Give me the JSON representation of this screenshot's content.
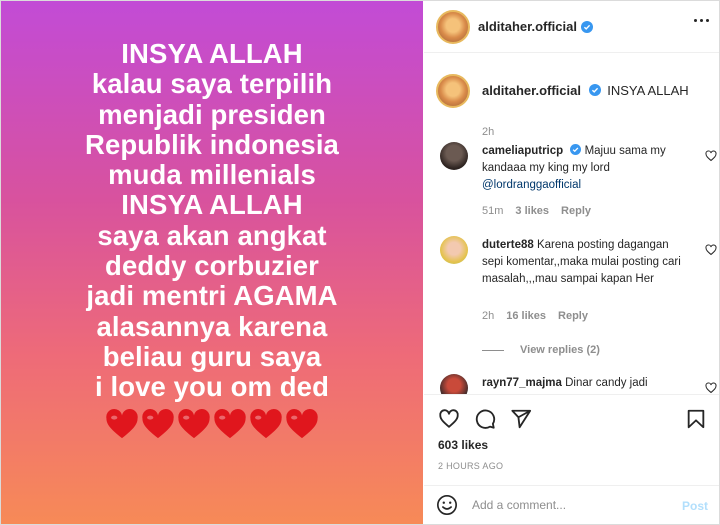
{
  "post_image": {
    "lines": [
      "INSYA ALLAH",
      "kalau saya terpilih",
      "menjadi presiden",
      "Republik indonesia",
      "muda millenials",
      "INSYA ALLAH",
      "saya akan angkat",
      "deddy corbuzier",
      "jadi mentri AGAMA",
      "alasannya karena",
      "beliau guru saya",
      "i love you om ded"
    ],
    "hearts_count": 6,
    "heart_color": "#e0161d",
    "gradient_top": "#c24bd6",
    "gradient_bottom": "#f78a57"
  },
  "header": {
    "username": "alditaher.official",
    "verified_icon": "verified-badge-icon",
    "more_icon": "more-options-icon"
  },
  "caption": {
    "username": "alditaher.official",
    "text": "INSYA ALLAH",
    "time": "2h"
  },
  "comments": [
    {
      "username": "cameliaputricp",
      "verified": true,
      "text": "Majuu sama my kandaaa my king my lord",
      "mention": "@lordranggaofficial",
      "time": "51m",
      "likes": "3 likes",
      "reply": "Reply"
    },
    {
      "username": "duterte88",
      "verified": false,
      "text": "Karena posting dagangan sepi komentar,,maka mulai posting cari masalah,,,mau sampai kapan Her",
      "time": "2h",
      "likes": "16 likes",
      "reply": "Reply",
      "view_replies": "View replies (2)"
    },
    {
      "username": "rayn77_majma",
      "verified": false,
      "text": "Dinar candy jadi"
    }
  ],
  "actions": {
    "like_icon": "heart-outline-icon",
    "comment_icon": "comment-bubble-icon",
    "share_icon": "paper-plane-icon",
    "save_icon": "bookmark-icon",
    "likes": "603 likes",
    "timestamp": "2 HOURS AGO"
  },
  "comment_box": {
    "emoji_icon": "smiley-icon",
    "placeholder": "Add a comment...",
    "post_label": "Post"
  },
  "colors": {
    "accent_blue": "#0095f6",
    "disabled_post": "#b2dffc",
    "muted_text": "#8e8e8e",
    "verified": "#3897f0"
  }
}
